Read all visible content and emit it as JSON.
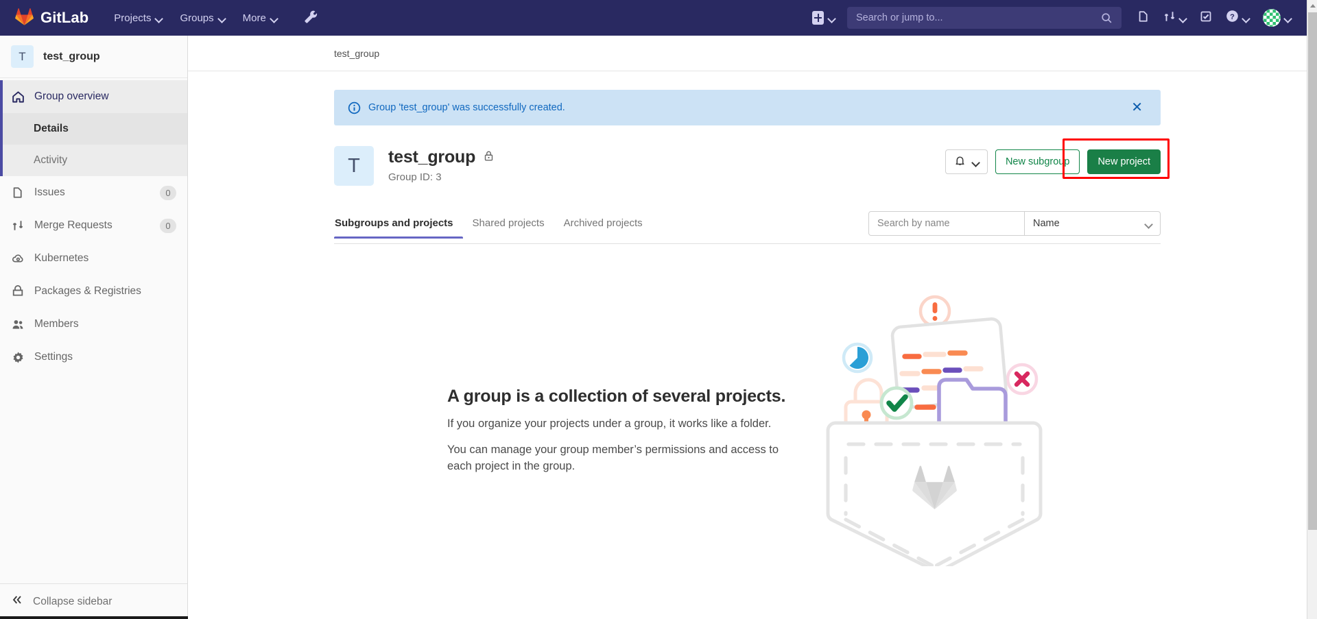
{
  "navbar": {
    "brand": "GitLab",
    "links": [
      {
        "label": "Projects",
        "icon": "chevron-down-icon"
      },
      {
        "label": "Groups",
        "icon": "chevron-down-icon"
      },
      {
        "label": "More",
        "icon": "chevron-down-icon"
      }
    ],
    "wrench_icon": "wrench-icon",
    "create_new_icon": "plus-square-icon",
    "search": {
      "placeholder": "Search or jump to...",
      "value": "",
      "icon": "search-icon"
    },
    "right_icons": [
      {
        "name": "issues-icon",
        "label": "Issues"
      },
      {
        "name": "merge-requests-icon",
        "label": "Merge requests"
      },
      {
        "name": "todos-icon",
        "label": "To-Do List"
      },
      {
        "name": "help-icon",
        "label": "Help"
      }
    ],
    "avatar": "user-avatar"
  },
  "sidebar": {
    "context": {
      "initial": "T",
      "name": "test_group"
    },
    "items": [
      {
        "label": "Group overview",
        "icon": "home-icon",
        "active": true,
        "count": ""
      },
      {
        "label": "Issues",
        "icon": "issues-icon",
        "active": false,
        "count": "0"
      },
      {
        "label": "Merge Requests",
        "icon": "merge-requests-icon",
        "active": false,
        "count": "0"
      },
      {
        "label": "Kubernetes",
        "icon": "kubernetes-icon",
        "active": false,
        "count": ""
      },
      {
        "label": "Packages & Registries",
        "icon": "package-icon",
        "active": false,
        "count": ""
      },
      {
        "label": "Members",
        "icon": "members-icon",
        "active": false,
        "count": ""
      },
      {
        "label": "Settings",
        "icon": "gear-icon",
        "active": false,
        "count": ""
      }
    ],
    "subitems": [
      {
        "label": "Details",
        "active": true
      },
      {
        "label": "Activity",
        "active": false
      }
    ],
    "collapse": {
      "label": "Collapse sidebar",
      "icon": "double-chevron-left-icon"
    }
  },
  "breadcrumb": {
    "items": [
      "test_group"
    ]
  },
  "alert": {
    "icon": "info-circle-icon",
    "message": "Group 'test_group' was successfully created.",
    "close_icon": "close-icon",
    "bg_color": "#cce2f5",
    "text_color": "#1068bf"
  },
  "group_header": {
    "avatar_initial": "T",
    "title": "test_group",
    "visibility_icon": "lock-icon",
    "subtitle": "Group ID: 3",
    "notification_button": {
      "icon": "bell-icon",
      "chevron": "chevron-down-icon"
    },
    "new_subgroup_button": "New subgroup",
    "new_project_button": "New project",
    "highlight_color": "#ff0000",
    "green_solid": "#1a7f47",
    "green_outline": "#108548"
  },
  "tabs": [
    {
      "label": "Subgroups and projects",
      "active": true
    },
    {
      "label": "Shared projects",
      "active": false
    },
    {
      "label": "Archived projects",
      "active": false
    }
  ],
  "filters": {
    "search": {
      "placeholder": "Search by name",
      "value": "",
      "icon": "search-input"
    },
    "sort": {
      "value": "Name",
      "icon": "chevron-down-icon"
    }
  },
  "empty_state": {
    "title": "A group is a collection of several projects.",
    "paragraphs": [
      "If you organize your projects under a group, it works like a folder.",
      "You can manage your group member’s permissions and access to each project in the group."
    ],
    "illustration": "group-empty-pocket-illustration"
  },
  "scrollbar": {
    "name": "page-scrollbar",
    "orientation": "vertical"
  }
}
